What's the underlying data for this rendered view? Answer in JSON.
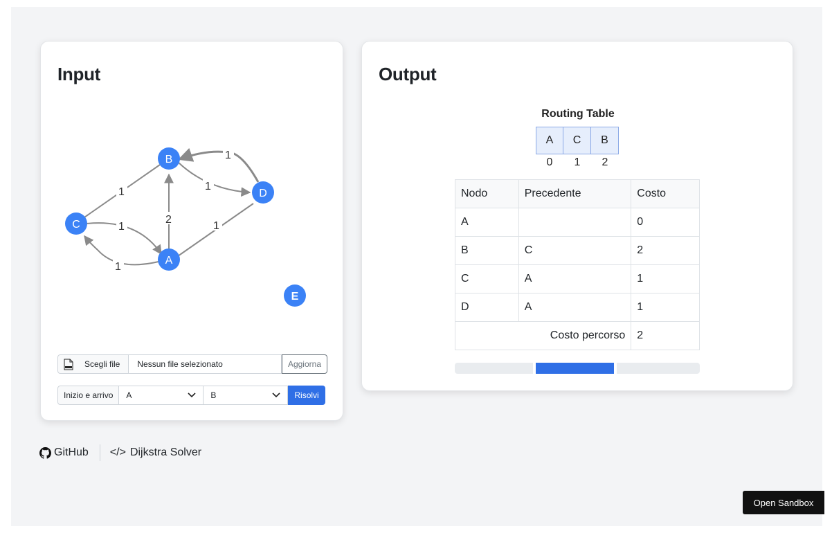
{
  "input": {
    "title": "Input",
    "graph": {
      "nodes": [
        {
          "id": "A",
          "color": "#3b82f6"
        },
        {
          "id": "B",
          "color": "#3b82f6"
        },
        {
          "id": "C",
          "color": "#3b82f6"
        },
        {
          "id": "D",
          "color": "#3b82f6"
        },
        {
          "id": "E",
          "color": "#3b82f6"
        }
      ],
      "edges": [
        {
          "from": "C",
          "to": "B",
          "weight": "1"
        },
        {
          "from": "C",
          "to": "A",
          "weight": "1"
        },
        {
          "from": "A",
          "to": "C",
          "weight": "1"
        },
        {
          "from": "A",
          "to": "B",
          "weight": "2"
        },
        {
          "from": "A",
          "to": "D",
          "weight": "1"
        },
        {
          "from": "B",
          "to": "D",
          "weight": "1"
        },
        {
          "from": "D",
          "to": "B",
          "weight": "1"
        }
      ]
    },
    "file": {
      "button_label": "Scegli file",
      "status": "Nessun file selezionato",
      "update_label": "Aggiorna"
    },
    "solve": {
      "label": "Inizio e arrivo",
      "start": "A",
      "end": "B",
      "button_label": "Risolvi"
    }
  },
  "output": {
    "title": "Output",
    "routing_title": "Routing Table",
    "routing": [
      {
        "node": "A",
        "index": "0"
      },
      {
        "node": "C",
        "index": "1"
      },
      {
        "node": "B",
        "index": "2"
      }
    ],
    "table": {
      "headers": [
        "Nodo",
        "Precedente",
        "Costo"
      ],
      "rows": [
        [
          "A",
          "",
          "0"
        ],
        [
          "B",
          "C",
          "2"
        ],
        [
          "C",
          "A",
          "1"
        ],
        [
          "D",
          "A",
          "1"
        ]
      ],
      "total_label": "Costo percorso",
      "total_value": "2"
    },
    "progress": {
      "segments": 3,
      "active_segment": 2
    }
  },
  "footer": {
    "github_label": "GitHub",
    "app_label": "Dijkstra Solver"
  },
  "sandbox_label": "Open Sandbox",
  "colors": {
    "accent": "#2f6fe6",
    "node": "#3b82f6",
    "edge": "#8a8a8a"
  }
}
